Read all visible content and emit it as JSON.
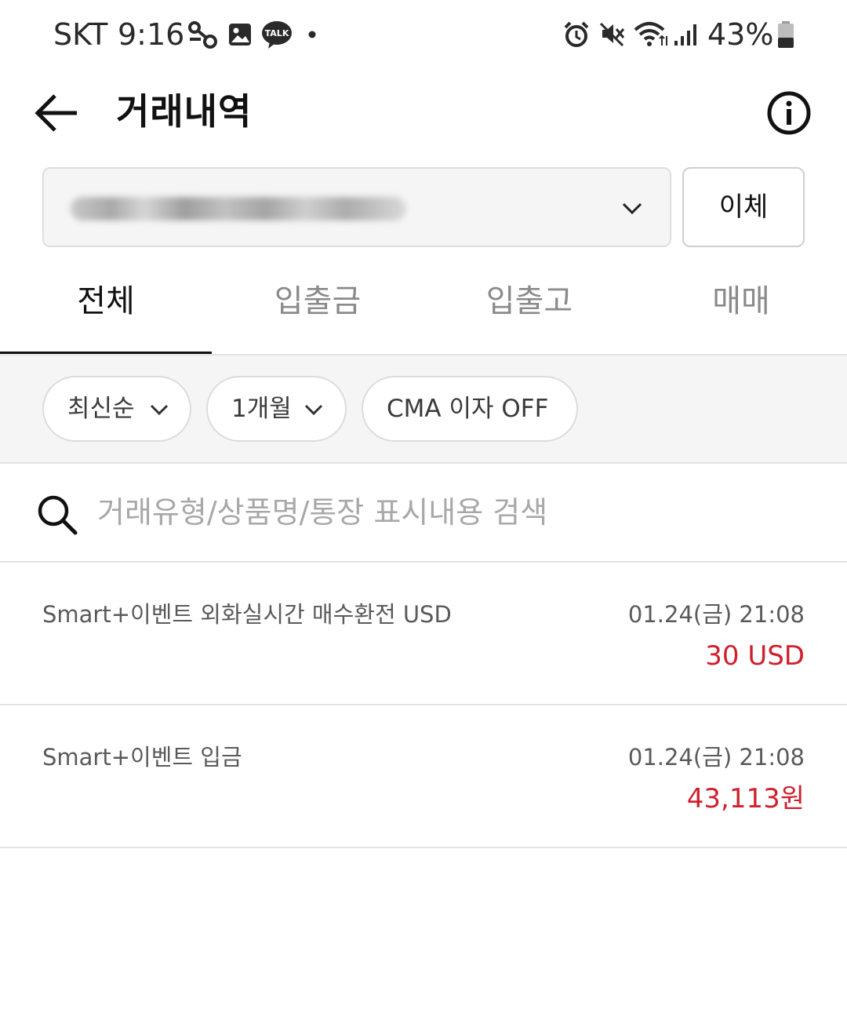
{
  "status_bar": {
    "carrier": "SKT",
    "time": "9:16",
    "notification_icons": [
      "link-icon",
      "gallery-icon",
      "kakaotalk-icon",
      "dot-icon"
    ],
    "kakao_badge": "TALK",
    "system_icons": [
      "alarm-icon",
      "mute-icon",
      "wifi-icon",
      "signal-icon"
    ],
    "battery_percent": "43%",
    "battery_level": 0.43
  },
  "header": {
    "title": "거래내역",
    "back_icon": "arrow-left-icon",
    "info_icon": "info-icon"
  },
  "account": {
    "selected_value": "",
    "value_redacted": true,
    "transfer_label": "이체"
  },
  "tabs": [
    {
      "label": "전체",
      "active": true
    },
    {
      "label": "입출금",
      "active": false
    },
    {
      "label": "입출고",
      "active": false
    },
    {
      "label": "매매",
      "active": false
    }
  ],
  "filters": {
    "sort_label": "최신순",
    "period_label": "1개월",
    "cma_label": "CMA 이자 OFF"
  },
  "search": {
    "placeholder": "거래유형/상품명/통장 표시내용 검색",
    "value": ""
  },
  "transactions": [
    {
      "name": "Smart+이벤트 외화실시간 매수환전 USD",
      "datetime": "01.24(금) 21:08",
      "amount": "30 USD"
    },
    {
      "name": "Smart+이벤트 입금",
      "datetime": "01.24(금) 21:08",
      "amount": "43,113원"
    }
  ],
  "colors": {
    "amount": "#d0202e",
    "active_tab": "#111111",
    "inactive_tab": "#8a8a8a",
    "filter_band": "#f5f5f5"
  }
}
